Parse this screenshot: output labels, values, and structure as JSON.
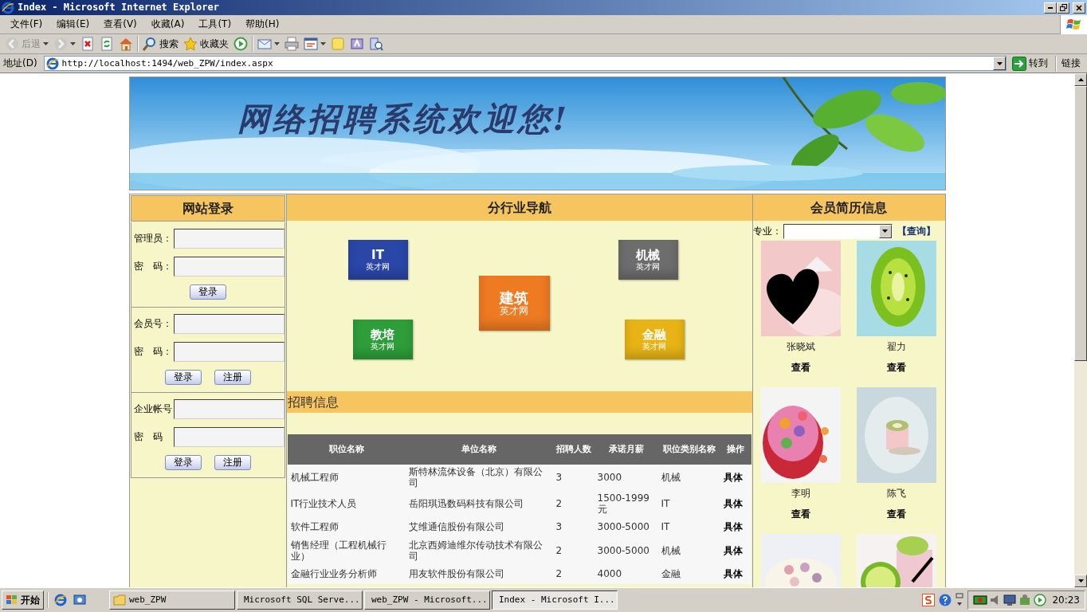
{
  "window": {
    "title": "Index - Microsoft Internet Explorer"
  },
  "menu": [
    "文件(F)",
    "编辑(E)",
    "查看(V)",
    "收藏(A)",
    "工具(T)",
    "帮助(H)"
  ],
  "toolbar": [
    {
      "kind": "back",
      "label": "后退",
      "disabled": true,
      "has_menu": true
    },
    {
      "kind": "forward",
      "disabled": true,
      "has_menu": true
    },
    {
      "kind": "stop",
      "disabled": false,
      "has_menu": false
    },
    {
      "kind": "refresh",
      "disabled": false,
      "has_menu": false
    },
    {
      "kind": "home",
      "disabled": false,
      "has_menu": false
    },
    {
      "kind": "separator"
    },
    {
      "kind": "search",
      "label": "搜索",
      "disabled": false,
      "has_menu": false
    },
    {
      "kind": "favorites",
      "label": "收藏夹",
      "disabled": false,
      "has_menu": false
    },
    {
      "kind": "media",
      "disabled": false,
      "has_menu": false
    },
    {
      "kind": "separator"
    },
    {
      "kind": "mail",
      "disabled": false,
      "has_menu": true
    },
    {
      "kind": "print",
      "disabled": false,
      "has_menu": false
    },
    {
      "kind": "edit",
      "disabled": false,
      "has_menu": true
    },
    {
      "kind": "note",
      "disabled": false,
      "has_menu": false
    },
    {
      "kind": "messenger",
      "disabled": false,
      "has_menu": false
    },
    {
      "kind": "research",
      "disabled": false,
      "has_menu": false
    }
  ],
  "address": {
    "label": "地址(D)",
    "url": "http://localhost:1494/web_ZPW/index.aspx",
    "go": "转到",
    "links": "链接"
  },
  "banner": {
    "title": "网络招聘系统欢迎您!"
  },
  "login": {
    "title": "网站登录",
    "groups": [
      {
        "fields": [
          {
            "label": "管理员："
          },
          {
            "label": "密　码："
          }
        ],
        "buttons": [
          "登录"
        ]
      },
      {
        "fields": [
          {
            "label": "会员号："
          },
          {
            "label": "密　码："
          }
        ],
        "buttons": [
          "登录",
          "注册"
        ]
      },
      {
        "fields": [
          {
            "label": "企业帐号"
          },
          {
            "label": "密　码"
          }
        ],
        "buttons": [
          "登录",
          "注册"
        ]
      }
    ]
  },
  "industry_nav": {
    "title": "分行业导航",
    "tiles": [
      {
        "name": "IT",
        "sub": "英才网",
        "color": "#2a47a8"
      },
      {
        "name": "机械",
        "sub": "英才网",
        "color": "#6d6d6d"
      },
      {
        "name": "建筑",
        "sub": "英才网",
        "color": "#ee7a22"
      },
      {
        "name": "教培",
        "sub": "英才网",
        "color": "#2e9e3a"
      },
      {
        "name": "金融",
        "sub": "英才网",
        "color": "#e8b415"
      }
    ]
  },
  "jobs": {
    "title": "招聘信息",
    "columns": [
      "职位名称",
      "单位名称",
      "招聘人数",
      "承诺月薪",
      "职位类别名称",
      "操作"
    ],
    "rows": [
      [
        "机械工程师",
        "斯特林流体设备（北京）有限公司",
        "3",
        "3000",
        "机械",
        "具体"
      ],
      [
        "IT行业技术人员",
        "岳阳琪迅数码科技有限公司",
        "2",
        "1500-1999元",
        "IT",
        "具体"
      ],
      [
        "软件工程师",
        "艾维通信股份有限公司",
        "3",
        "3000-5000",
        "IT",
        "具体"
      ],
      [
        "销售经理（工程机械行业）",
        "北京西姆迪维尔传动技术有限公司",
        "2",
        "3000-5000",
        "机械",
        "具体"
      ],
      [
        "金融行业业务分析师",
        "用友软件股份有限公司",
        "2",
        "4000",
        "金融",
        "具体"
      ]
    ]
  },
  "resumes": {
    "title": "会员简历信息",
    "filter_label": "专业：",
    "query": "【查询】",
    "members": [
      {
        "kind": "member",
        "name": "张晓斌",
        "action": "查看"
      },
      {
        "kind": "member",
        "name": "翟力",
        "action": "查看"
      },
      {
        "kind": "member",
        "name": "李明",
        "action": "查看"
      },
      {
        "kind": "member",
        "name": "陈飞",
        "action": "查看"
      },
      {
        "kind": "picture"
      },
      {
        "kind": "picture"
      }
    ]
  },
  "taskbar": {
    "start": "开始",
    "tasks": [
      {
        "kind": "folder",
        "label": "web_ZPW",
        "selected": false
      },
      {
        "kind": "sql",
        "label": "Microsoft SQL Serve...",
        "selected": false
      },
      {
        "kind": "studio",
        "label": "web_ZPW - Microsoft...",
        "selected": false
      },
      {
        "kind": "ie",
        "label": "Index - Microsoft I...",
        "selected": true
      }
    ],
    "clock": "20:23"
  }
}
